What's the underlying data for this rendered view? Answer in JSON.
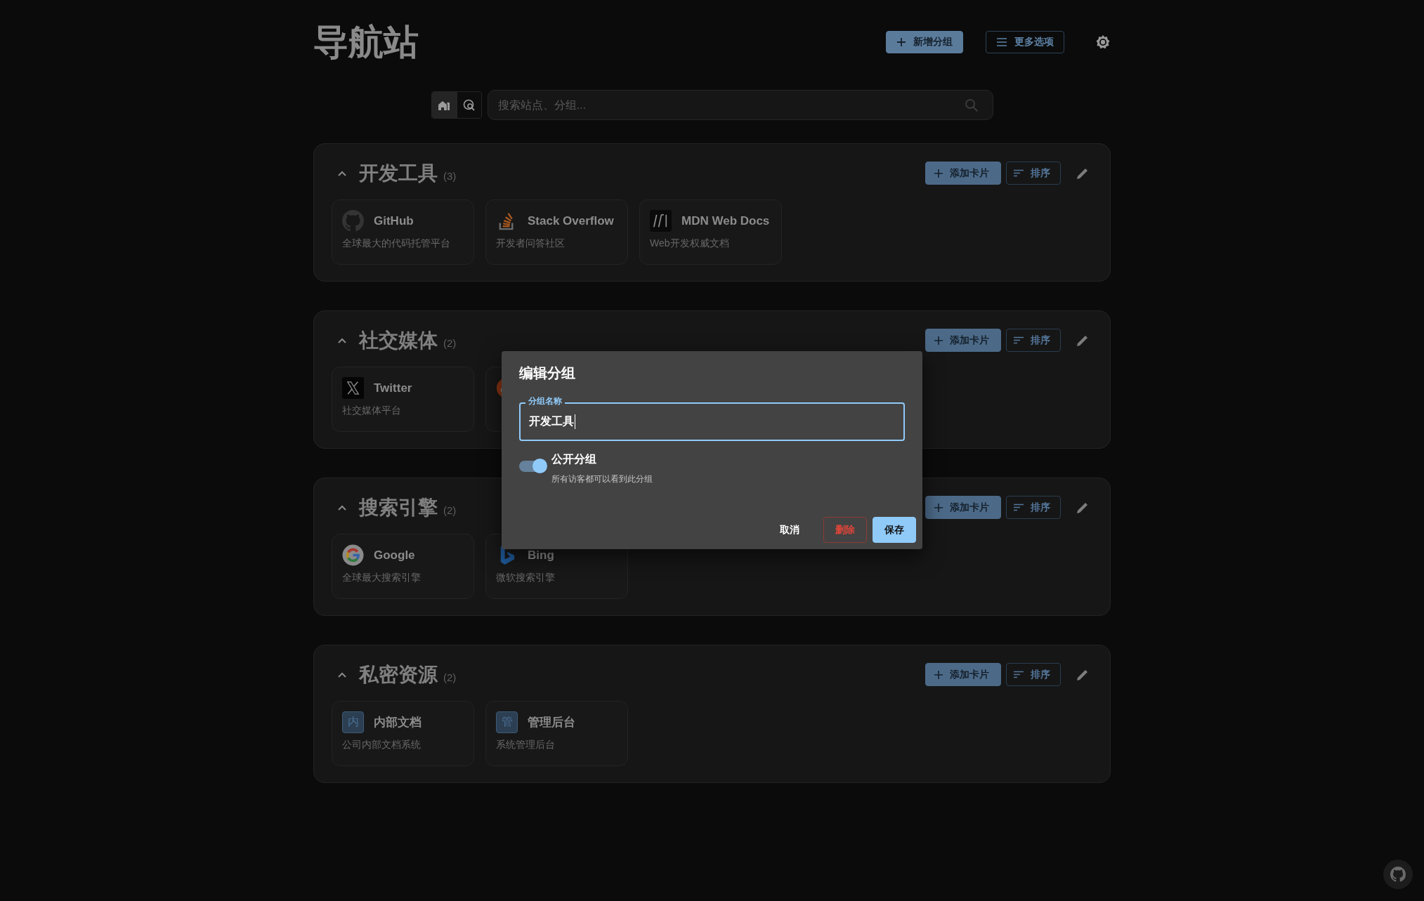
{
  "header": {
    "title": "导航站",
    "buttons": [
      {
        "label": "新增分组",
        "kind": "add"
      },
      {
        "label": "更多选项",
        "kind": "menu"
      }
    ]
  },
  "search": {
    "modes": [
      {
        "kind": "site",
        "selected": true
      },
      {
        "kind": "web",
        "selected": false
      }
    ],
    "placeholder": "搜索站点、分组..."
  },
  "groups": [
    {
      "name": "开发工具",
      "count": "(3)",
      "expanded": true,
      "actions": [
        "添加卡片",
        "排序"
      ],
      "cards": [
        {
          "kind": "logo",
          "title": "GitHub",
          "description": "全球最大的代码托管平台"
        },
        {
          "kind": "logo",
          "title": "Stack Overflow",
          "description": "开发者问答社区"
        },
        {
          "kind": "logo",
          "title": "MDN Web Docs",
          "description": "Web开发权威文档"
        }
      ]
    },
    {
      "name": "社交媒体",
      "count": "(2)",
      "expanded": true,
      "actions": [
        "添加卡片",
        "排序"
      ],
      "cards": [
        {
          "kind": "logo",
          "title": "Twitter",
          "description": "社交媒体平台"
        },
        {
          "kind": "logo"
        }
      ]
    },
    {
      "name": "搜索引擎",
      "count": "(2)",
      "expanded": true,
      "actions": [
        "添加卡片",
        "排序"
      ],
      "cards": [
        {
          "kind": "logo",
          "title": "Google",
          "description": "全球最大搜索引擎"
        },
        {
          "kind": "logo",
          "title": "Bing",
          "description": "微软搜索引擎"
        }
      ]
    },
    {
      "name": "私密资源",
      "count": "(2)",
      "expanded": true,
      "actions": [
        "添加卡片",
        "排序"
      ],
      "cards": [
        {
          "kind": "letter",
          "badge": "内",
          "title": "内部文档",
          "description": "公司内部文档系统"
        },
        {
          "kind": "letter",
          "badge": "管",
          "title": "管理后台",
          "description": "系统管理后台"
        }
      ]
    }
  ],
  "dialog": {
    "title": "编辑分组",
    "field": {
      "label": "分组名称",
      "value": "开发工具"
    },
    "switch": {
      "label": "公开分组",
      "helper": "所有访客都可以看到此分组",
      "on": true
    },
    "buttons": [
      {
        "label": "取消",
        "kind": "text"
      },
      {
        "label": "删除",
        "kind": "danger"
      },
      {
        "label": "保存",
        "kind": "primary"
      }
    ]
  }
}
